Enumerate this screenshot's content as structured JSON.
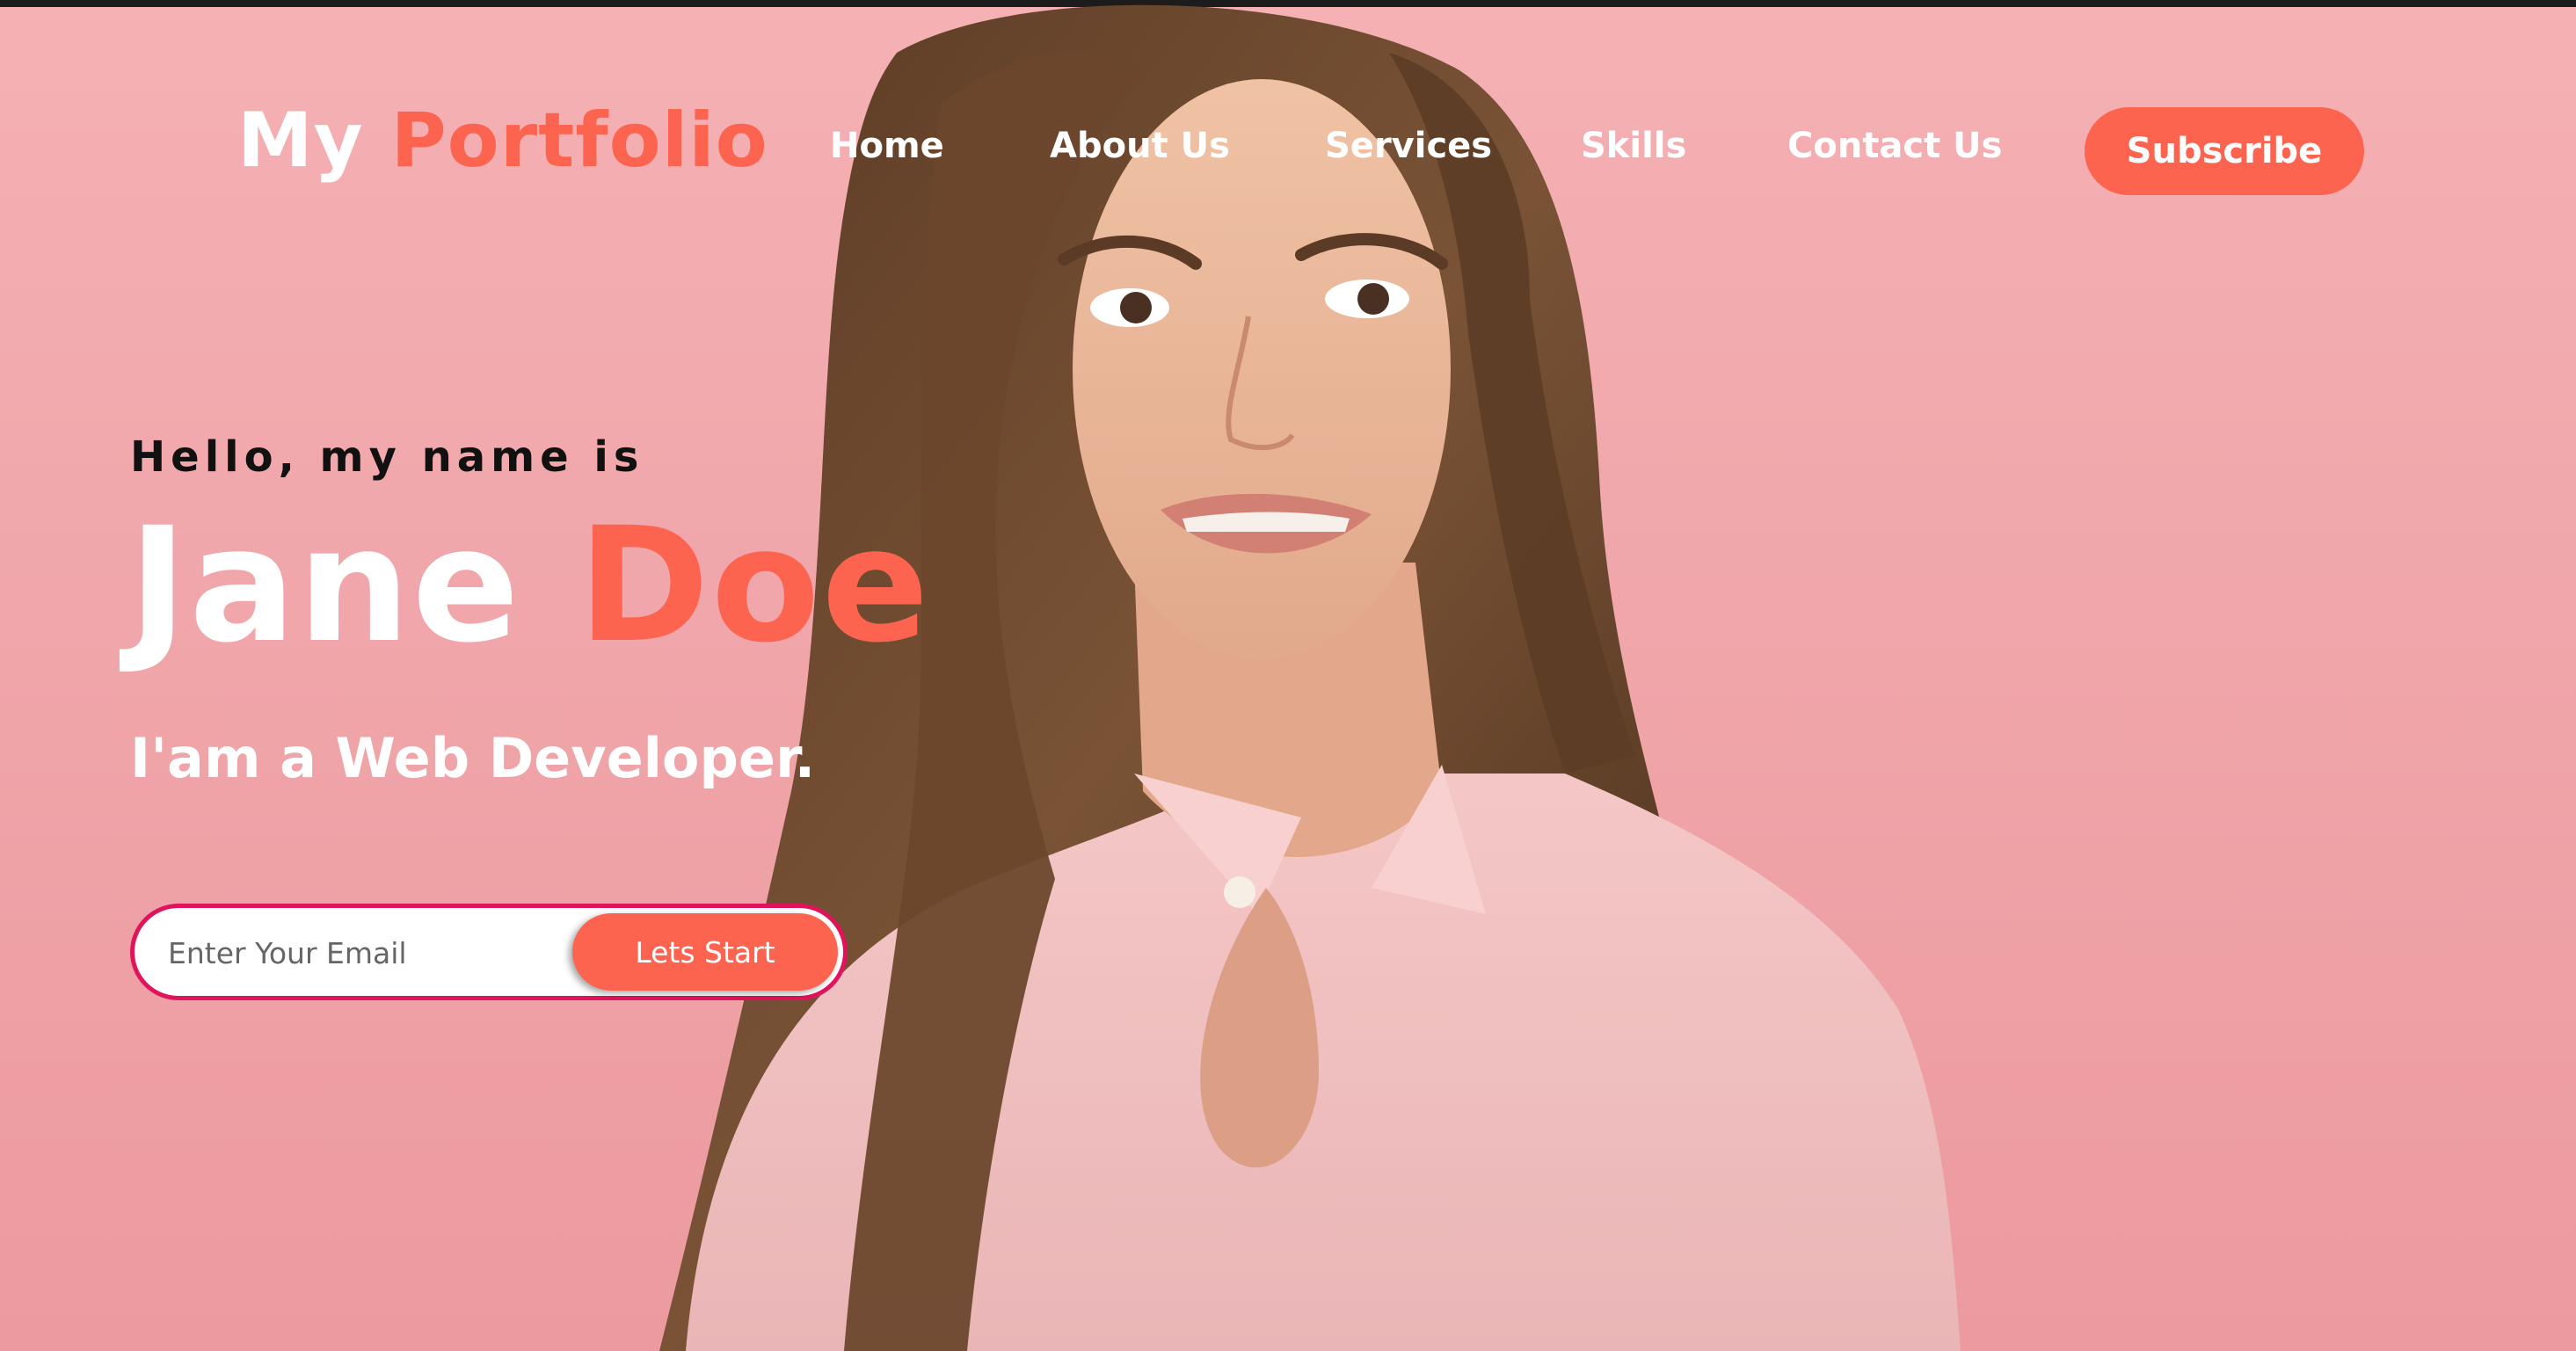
{
  "colors": {
    "accent": "#fd6450",
    "background": "#f3acb0",
    "form_border": "#e0145a"
  },
  "header": {
    "logo_first": "My",
    "logo_second": "Portfolio",
    "nav": [
      "Home",
      "About Us",
      "Services",
      "Skills",
      "Contact Us"
    ],
    "subscribe_label": "Subscribe"
  },
  "hero": {
    "greeting": "Hello, my name is",
    "first_name": "Jane",
    "last_name": "Doe",
    "role": "I'am a Web Developer.",
    "email_placeholder": "Enter Your Email",
    "cta_label": "Lets Start"
  }
}
